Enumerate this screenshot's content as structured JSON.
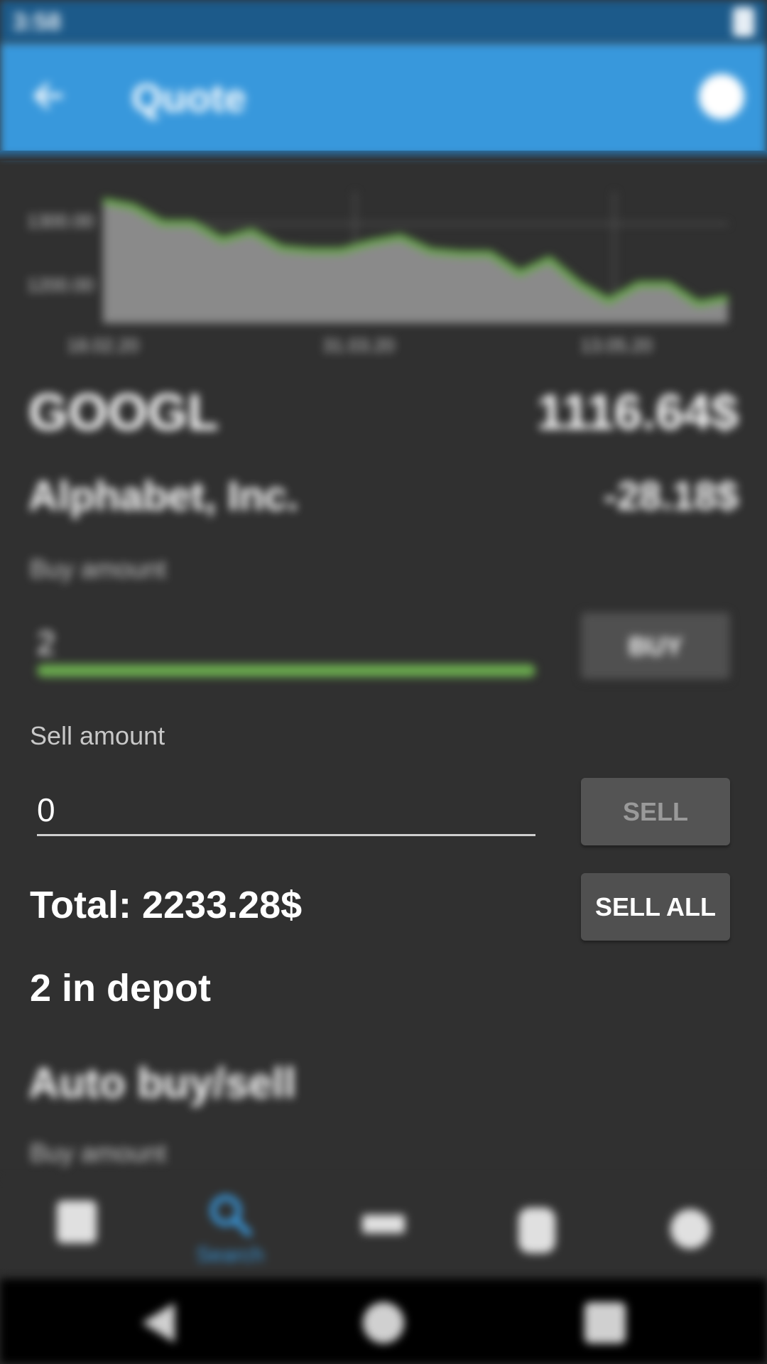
{
  "status_bar": {
    "time": "3:58"
  },
  "app_bar": {
    "title": "Quote"
  },
  "chart_data": {
    "type": "area",
    "title": "",
    "xlabel": "",
    "ylabel": "",
    "x_ticks": [
      "18.02.20",
      "31.03.20",
      "13.05.20"
    ],
    "y_ticks": [
      "1300.00",
      "1200.00"
    ],
    "series": [
      {
        "values": [
          1340,
          1330,
          1300,
          1300,
          1270,
          1285,
          1255,
          1250,
          1250,
          1265,
          1275,
          1250,
          1245,
          1245,
          1210,
          1235,
          1190,
          1160,
          1190,
          1190,
          1155,
          1165
        ]
      }
    ],
    "colors": {
      "line": "#6aaa4e",
      "fill": "#8a8a8a"
    },
    "grid": true
  },
  "quote": {
    "symbol": "GOOGL",
    "price": "1116.64$",
    "company": "Alphabet, Inc.",
    "change": "-28.18$"
  },
  "buy": {
    "label": "Buy amount",
    "value": "2",
    "button": "BUY",
    "accent": "#6aaa4e"
  },
  "sell": {
    "label": "Sell amount",
    "value": "0",
    "button": "SELL"
  },
  "total": "Total: 2233.28$",
  "sell_all": "SELL ALL",
  "depot": "2 in depot",
  "auto": {
    "title": "Auto buy/sell",
    "buy_label": "Buy amount"
  },
  "bottom_nav": {
    "items": [
      {
        "icon": "portfolio-icon",
        "label": ""
      },
      {
        "icon": "search-icon",
        "label": "Search"
      },
      {
        "icon": "stats-icon",
        "label": ""
      },
      {
        "icon": "history-icon",
        "label": ""
      },
      {
        "icon": "settings-icon",
        "label": ""
      }
    ],
    "active_color": "#3898dc"
  }
}
